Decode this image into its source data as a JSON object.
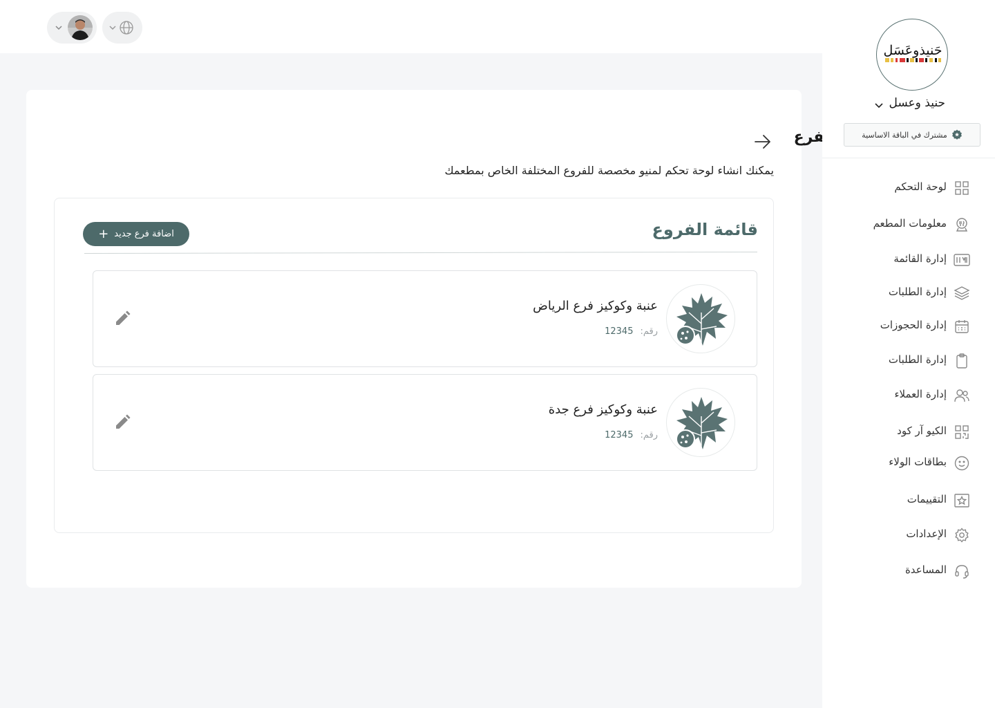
{
  "page": {
    "title": "انشاء حساب للفرع",
    "description": "يمكنك انشاء لوحة تحكم لمنيو مخصصة للفروع المختلفة الخاص بمطعمك"
  },
  "branches_section": {
    "title": "قائمة الفروع",
    "add_button_label": "اضافة فرع جديد",
    "items": [
      {
        "name": "عنبة وكوكيز فرع الرياض",
        "number_label": "رقم:",
        "number": "12345"
      },
      {
        "name": "عنبة وكوكيز فرع جدة",
        "number_label": "رقم:",
        "number": "12345"
      }
    ]
  },
  "sidebar": {
    "restaurant_name": "حنيذ وعسل",
    "logo_text": "حَنيذوعَسَل",
    "plan_badge": "مشترك في الباقة الاساسية",
    "items": [
      {
        "label": "لوحة التحكم",
        "icon": "dashboard-grid-icon"
      },
      {
        "label": "معلومات المطعم",
        "icon": "restaurant-info-icon"
      },
      {
        "label": "إدارة القائمة",
        "icon": "menu-management-icon"
      },
      {
        "label": "إدارة الطلبات",
        "icon": "layers-icon"
      },
      {
        "label": "إدارة الحجوزات",
        "icon": "calendar-icon"
      },
      {
        "label": "إدارة الطلبات",
        "icon": "clipboard-icon"
      },
      {
        "label": "إدارة العملاء",
        "icon": "users-icon"
      },
      {
        "label": "الكيو آر كود",
        "icon": "qr-code-icon"
      },
      {
        "label": "بطاقات الولاء",
        "icon": "smiley-icon"
      },
      {
        "label": "التقييمات",
        "icon": "star-icon"
      },
      {
        "label": "الإعدادات",
        "icon": "gear-icon"
      },
      {
        "label": "المساعدة",
        "icon": "headset-icon"
      }
    ]
  },
  "colors": {
    "accent": "#4d6a6a",
    "background": "#f5f6f8"
  }
}
